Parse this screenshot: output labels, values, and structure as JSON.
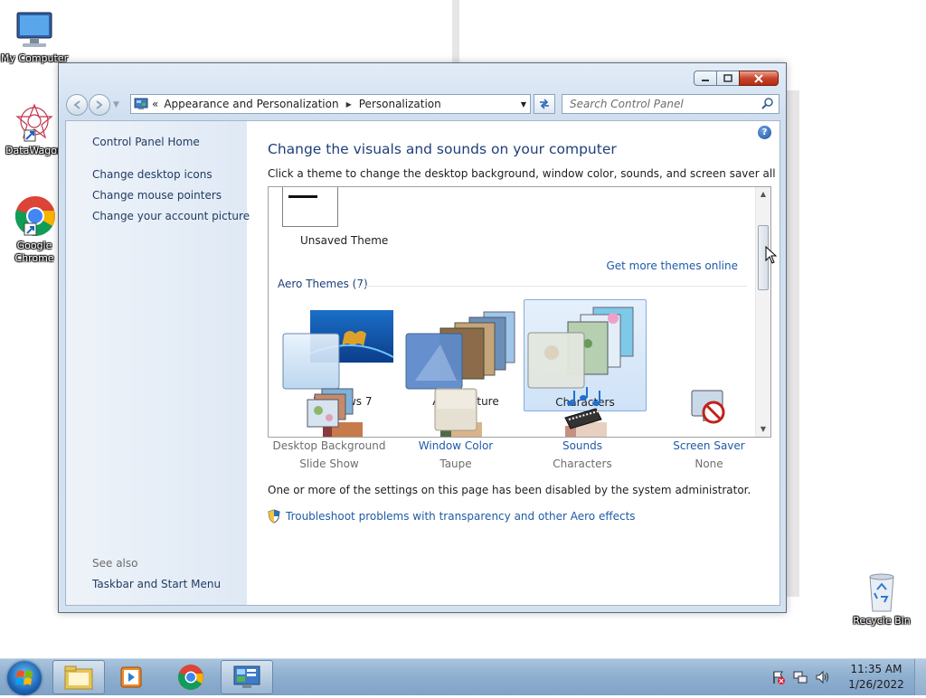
{
  "desktop": {
    "icons": [
      {
        "label": "My Computer"
      },
      {
        "label": "DataWagon"
      },
      {
        "label": "Google Chrome"
      },
      {
        "label": "Recycle Bin"
      }
    ]
  },
  "window": {
    "address": {
      "overflow": "«",
      "crumbs": [
        "Appearance and Personalization",
        "Personalization"
      ]
    },
    "search_placeholder": "Search Control Panel",
    "help": "?",
    "left_pane": {
      "home": "Control Panel Home",
      "links": [
        "Change desktop icons",
        "Change mouse pointers",
        "Change your account picture"
      ],
      "see_also_label": "See also",
      "see_also": [
        "Taskbar and Start Menu"
      ]
    },
    "main": {
      "title": "Change the visuals and sounds on your computer",
      "subtitle": "Click a theme to change the desktop background, window color, sounds, and screen saver all at once.",
      "themes_panel": {
        "unsaved_label": "Unsaved Theme",
        "more_link": "Get more themes online",
        "group_header": "Aero Themes (7)",
        "themes": [
          {
            "label": "Windows 7",
            "selected": false
          },
          {
            "label": "Architecture",
            "selected": false
          },
          {
            "label": "Characters",
            "selected": true
          }
        ]
      },
      "settings": [
        {
          "title": "Desktop Background",
          "value": "Slide Show",
          "title_color": "#6d6d6d"
        },
        {
          "title": "Window Color",
          "value": "Taupe",
          "title_color": "#1e5aa8"
        },
        {
          "title": "Sounds",
          "value": "Characters",
          "title_color": "#1e5aa8"
        },
        {
          "title": "Screen Saver",
          "value": "None",
          "title_color": "#1e5aa8"
        }
      ],
      "notice": "One or more of the settings on this page has been disabled by the system administrator.",
      "troubleshoot_link": "Troubleshoot problems with transparency and other Aero effects"
    }
  },
  "taskbar": {
    "pinned": [
      "windows-explorer",
      "media-player",
      "google-chrome",
      "control-panel"
    ],
    "active": "control-panel",
    "clock": {
      "time": "11:35 AM",
      "date": "1/26/2022"
    }
  },
  "colors": {
    "link": "#1e5aa8",
    "heading": "#1e3f7a",
    "selected_tile": "#cfe2f7"
  }
}
